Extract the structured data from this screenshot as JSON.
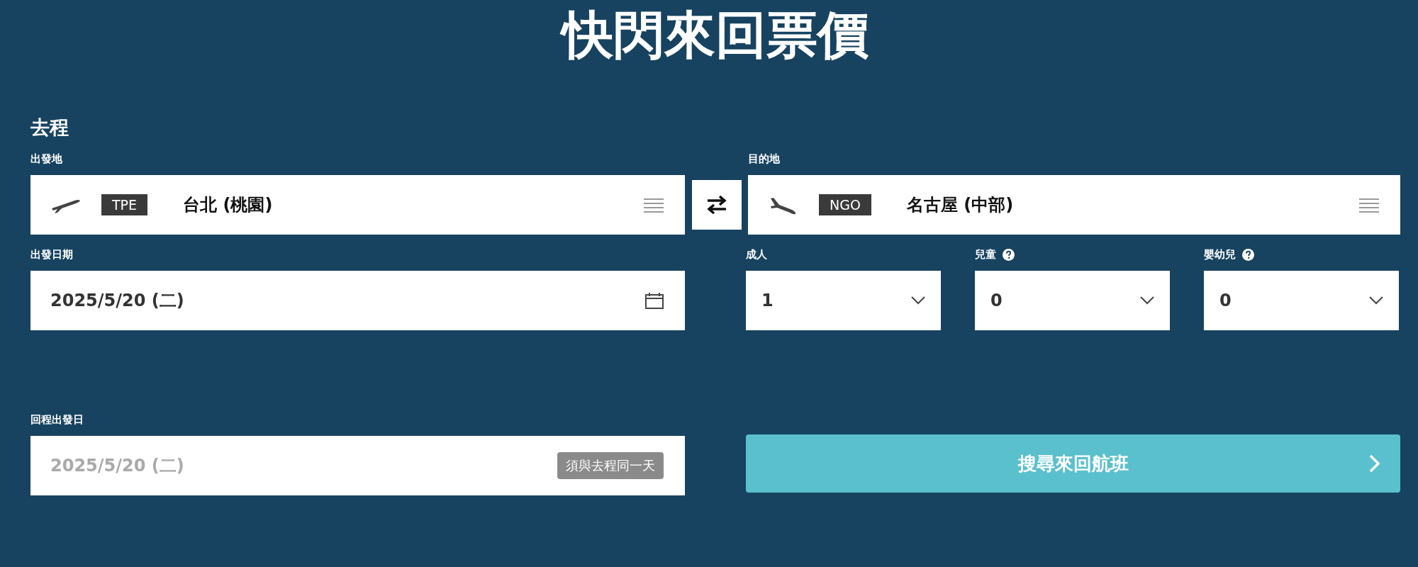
{
  "title": "快閃來回票價",
  "section": "去程",
  "origin": {
    "label": "出發地",
    "code": "TPE",
    "city": "台北 (桃園)"
  },
  "destination": {
    "label": "目的地",
    "code": "NGO",
    "city": "名古屋 (中部)"
  },
  "departure_date": {
    "label": "出發日期",
    "value": "2025/5/20 (二)"
  },
  "passengers": [
    {
      "label": "成人",
      "help": false,
      "value": "1"
    },
    {
      "label": "兒童",
      "help": true,
      "value": "0"
    },
    {
      "label": "嬰幼兒",
      "help": true,
      "value": "0"
    }
  ],
  "return_date": {
    "label": "回程出發日",
    "value": "2025/5/20 (二)",
    "disabled": true,
    "note": "須與去程同一天"
  },
  "search_button": {
    "label": "搜尋來回航班"
  }
}
